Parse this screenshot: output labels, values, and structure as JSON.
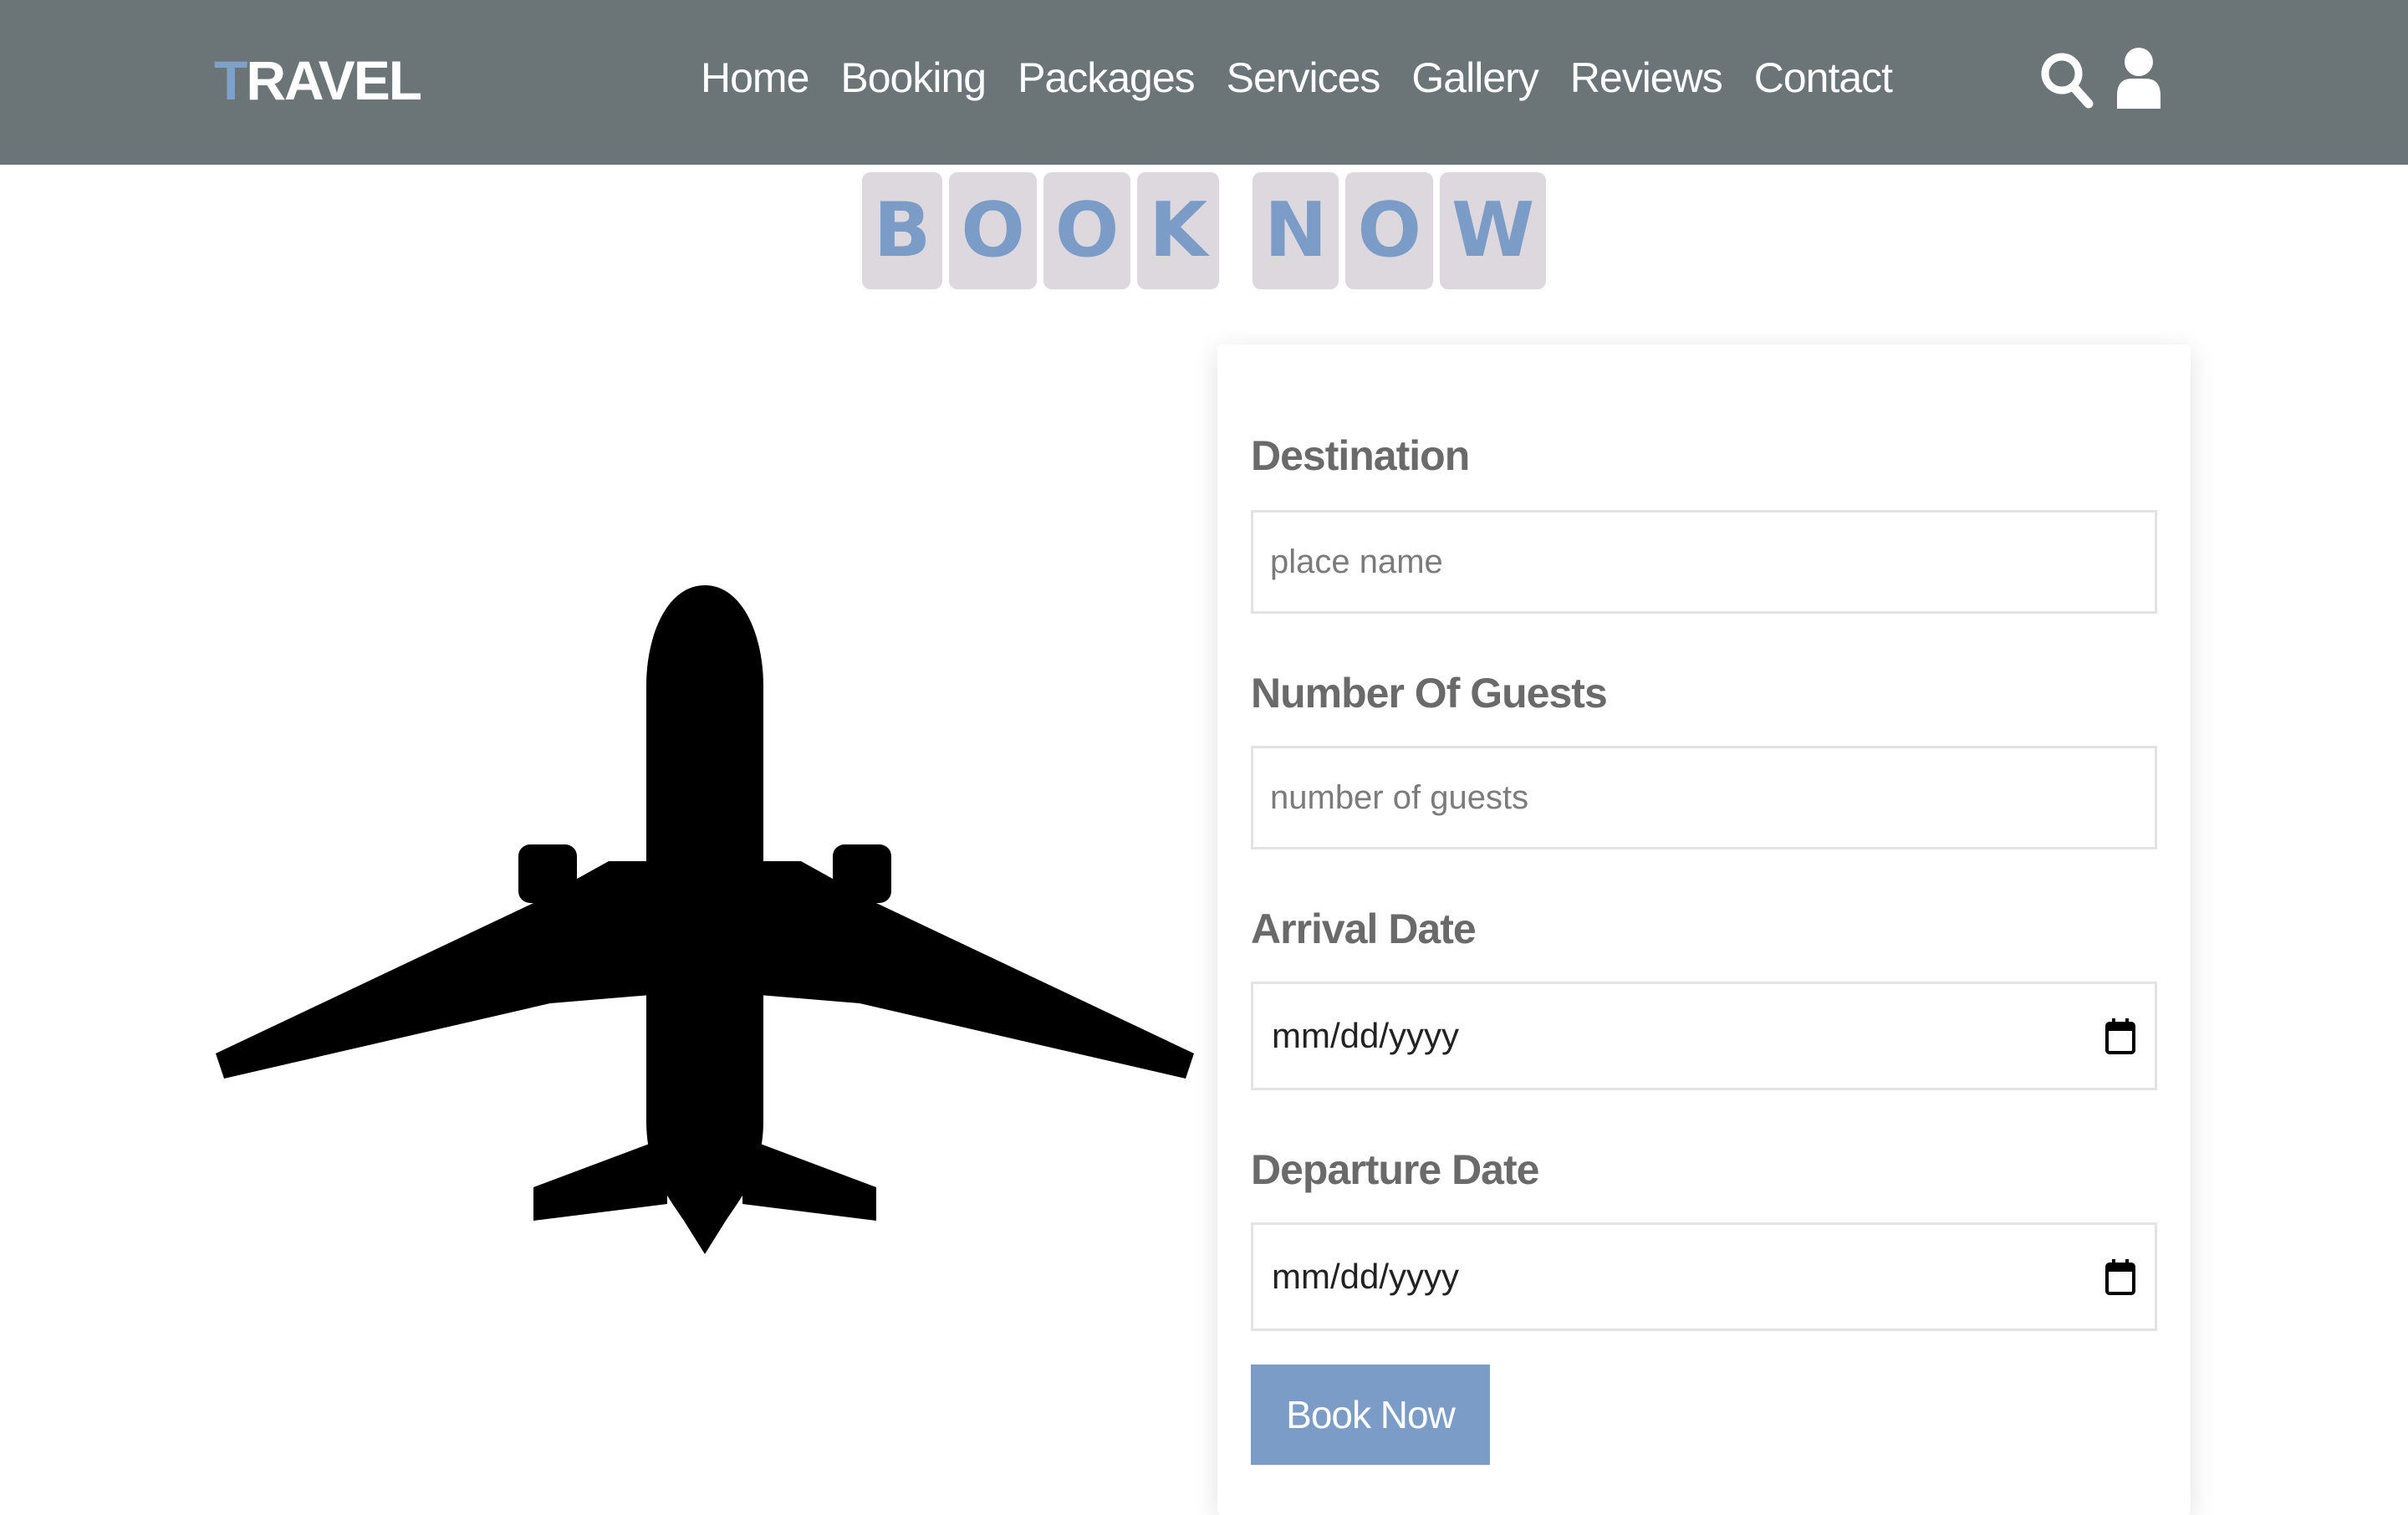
{
  "header": {
    "logo_first": "T",
    "logo_rest": "RAVEL",
    "nav": [
      "Home",
      "Booking",
      "Packages",
      "Services",
      "Gallery",
      "Reviews",
      "Contact"
    ],
    "icons": [
      "search-icon",
      "user-icon"
    ]
  },
  "title": {
    "word1": [
      "B",
      "O",
      "O",
      "K"
    ],
    "word2": [
      "N",
      "O",
      "W"
    ]
  },
  "form": {
    "destination_label": "Destination",
    "destination_placeholder": "place name",
    "guests_label": "Number Of Guests",
    "guests_placeholder": "number of guests",
    "arrival_label": "Arrival Date",
    "arrival_value": "mm/dd/yyyy",
    "departure_label": "Departure Date",
    "departure_value": "mm/dd/yyyy",
    "submit_label": "Book Now"
  },
  "colors": {
    "header_bg": "#6b7476",
    "accent": "#7a9cc6",
    "letter_tile": "#ddd7de"
  }
}
